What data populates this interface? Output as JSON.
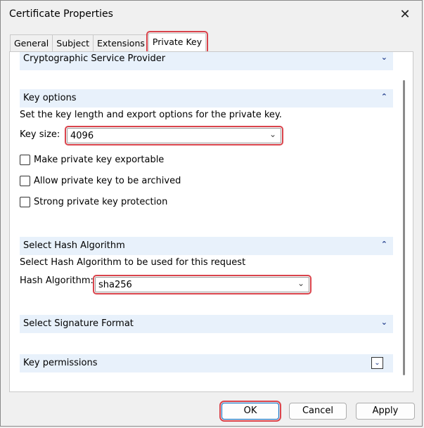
{
  "window": {
    "title": "Certificate Properties"
  },
  "tabs": [
    {
      "label": "General"
    },
    {
      "label": "Subject"
    },
    {
      "label": "Extensions"
    },
    {
      "label": "Private Key"
    }
  ],
  "sections": {
    "csp": {
      "label": "Cryptographic Service Provider"
    },
    "key_options": {
      "label": "Key options",
      "description": "Set the key length and export options for the private key.",
      "key_size_label": "Key size:",
      "key_size_value": "4096",
      "checkboxes": [
        {
          "label": "Make private key exportable",
          "checked": false
        },
        {
          "label": "Allow private key to be archived",
          "checked": false
        },
        {
          "label": "Strong private key protection",
          "checked": false
        }
      ]
    },
    "hash": {
      "label": "Select Hash Algorithm",
      "description": "Select Hash Algorithm to be used for this request",
      "algo_label": "Hash Algorithm:",
      "algo_value": "sha256"
    },
    "signature": {
      "label": "Select Signature Format"
    },
    "permissions": {
      "label": "Key permissions"
    }
  },
  "buttons": {
    "ok": "OK",
    "cancel": "Cancel",
    "apply": "Apply"
  },
  "icons": {
    "close": "close-icon",
    "expand": "chevron-down-icon",
    "collapse": "chevron-up-icon"
  },
  "colors": {
    "highlight": "#d9434b",
    "section_bg": "#e8f1fb",
    "chevron": "#1e3a8a"
  }
}
